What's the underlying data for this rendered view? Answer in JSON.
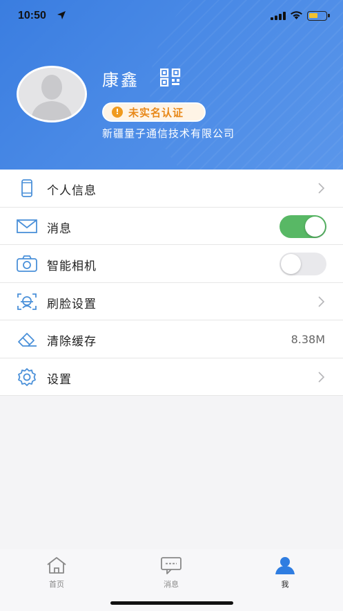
{
  "status_bar": {
    "time": "10:50"
  },
  "profile": {
    "name": "康鑫",
    "verify_badge": "未实名认证",
    "company": "新疆量子通信技术有限公司"
  },
  "menu": [
    {
      "label": "个人信息",
      "icon": "phone-icon",
      "accessory": "chevron"
    },
    {
      "label": "消息",
      "icon": "envelope-icon",
      "accessory": "toggle",
      "toggle_on": true
    },
    {
      "label": "智能相机",
      "icon": "camera-icon",
      "accessory": "toggle",
      "toggle_on": false
    },
    {
      "label": "刷脸设置",
      "icon": "face-scan-icon",
      "accessory": "chevron"
    },
    {
      "label": "清除缓存",
      "icon": "eraser-icon",
      "accessory": "value",
      "value": "8.38M"
    },
    {
      "label": "设置",
      "icon": "gear-icon",
      "accessory": "chevron"
    }
  ],
  "tabbar": {
    "tabs": [
      {
        "label": "首页",
        "icon": "home-icon",
        "active": false
      },
      {
        "label": "消息",
        "icon": "chat-icon",
        "active": false
      },
      {
        "label": "我",
        "icon": "person-icon",
        "active": true
      }
    ]
  },
  "colors": {
    "header_blue": "#3a7de0",
    "toggle_on": "#58b865",
    "badge_orange": "#e8891b",
    "icon_blue": "#4a90d9",
    "tab_active": "#2f7de1",
    "tab_inactive": "#888888"
  }
}
